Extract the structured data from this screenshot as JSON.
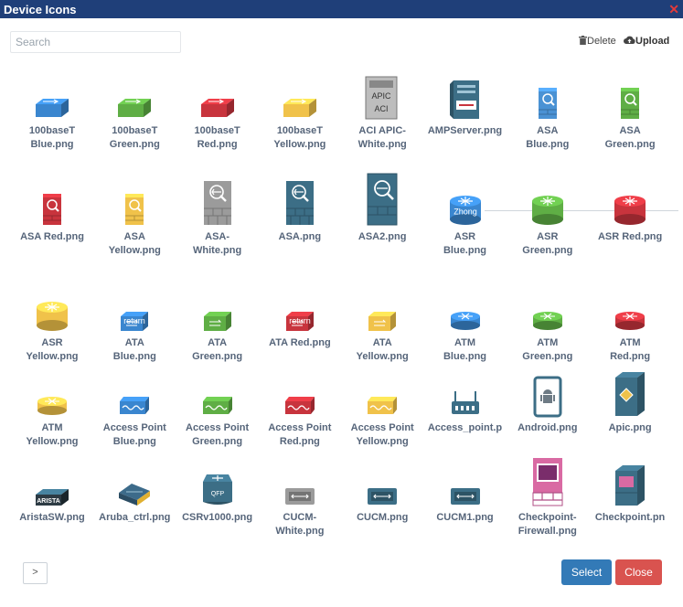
{
  "window": {
    "title": "Device Icons",
    "close_glyph": "✕"
  },
  "search": {
    "placeholder": "Search"
  },
  "toolbar": {
    "delete_label": "Delete",
    "upload_label": "Upload"
  },
  "footer": {
    "next_label": ">",
    "select_label": "Select",
    "close_label": "Close"
  },
  "icons": [
    {
      "label": "100baseT\nBlue.png",
      "type": "switch",
      "color": "#3a86cf"
    },
    {
      "label": "100baseT\nGreen.png",
      "type": "switch",
      "color": "#5fae45"
    },
    {
      "label": "100baseT\nRed.png",
      "type": "switch",
      "color": "#c8343d"
    },
    {
      "label": "100baseT\nYellow.png",
      "type": "switch",
      "color": "#f0c24a"
    },
    {
      "label": "ACI APIC-\nWhite.png",
      "type": "apic",
      "color": "#bdbdbd",
      "text1": "APIC",
      "text2": "ACI"
    },
    {
      "label": "AMPServer.png",
      "type": "server",
      "color": "#3c6e86"
    },
    {
      "label": "ASA\nBlue.png",
      "type": "asasmall",
      "color": "#4a92d4"
    },
    {
      "label": "ASA\nGreen.png",
      "type": "asasmall",
      "color": "#5fae45"
    },
    {
      "label": "ASA Red.png",
      "type": "asasmall",
      "color": "#c8343d"
    },
    {
      "label": "ASA\nYellow.png",
      "type": "asasmall",
      "color": "#f0c24a"
    },
    {
      "label": "ASA-\nWhite.png",
      "type": "asabig",
      "color": "#9b9b9b"
    },
    {
      "label": "ASA.png",
      "type": "asabig",
      "color": "#3c6e86"
    },
    {
      "label": "ASA2.png",
      "type": "asabig2",
      "color": "#3c6e86"
    },
    {
      "label": "ASR\nBlue.png",
      "type": "router",
      "color": "#3a86cf",
      "overlay": "Zhong"
    },
    {
      "label": "ASR\nGreen.png",
      "type": "router",
      "color": "#5fae45"
    },
    {
      "label": "ASR Red.png",
      "type": "router",
      "color": "#c8343d"
    },
    {
      "label": "ASR\nYellow.png",
      "type": "router",
      "color": "#f0c24a"
    },
    {
      "label": "ATA\nBlue.png",
      "type": "ata",
      "color": "#3a86cf",
      "overlay": "return"
    },
    {
      "label": "ATA\nGreen.png",
      "type": "ata",
      "color": "#5fae45"
    },
    {
      "label": "ATA Red.png",
      "type": "ata",
      "color": "#c8343d",
      "overlay": "return"
    },
    {
      "label": "ATA\nYellow.png",
      "type": "ata",
      "color": "#f0c24a"
    },
    {
      "label": "ATM\nBlue.png",
      "type": "atm",
      "color": "#3a86cf"
    },
    {
      "label": "ATM\nGreen.png",
      "type": "atm",
      "color": "#5fae45"
    },
    {
      "label": "ATM\nRed.png",
      "type": "atm",
      "color": "#c8343d"
    },
    {
      "label": "ATM\nYellow.png",
      "type": "atm",
      "color": "#f0c24a"
    },
    {
      "label": "Access Point\nBlue.png",
      "type": "ap",
      "color": "#3a86cf"
    },
    {
      "label": "Access Point\nGreen.png",
      "type": "ap",
      "color": "#5fae45"
    },
    {
      "label": "Access Point\nRed.png",
      "type": "ap",
      "color": "#c8343d"
    },
    {
      "label": "Access Point\nYellow.png",
      "type": "ap",
      "color": "#f0c24a"
    },
    {
      "label": "Access_point.p",
      "type": "wap",
      "color": "#3c6e86"
    },
    {
      "label": "Android.png",
      "type": "android",
      "color": "#3c6e86"
    },
    {
      "label": "Apic.png",
      "type": "apicbox",
      "color": "#3c6e86"
    },
    {
      "label": "AristaSW.png",
      "type": "arista",
      "color": "#3c6e86",
      "text1": "ARISTA"
    },
    {
      "label": "Aruba_ctrl.png",
      "type": "aruba",
      "color": "#3c6e86"
    },
    {
      "label": "CSRv1000.png",
      "type": "csr",
      "color": "#3c6e86",
      "text1": "QFP"
    },
    {
      "label": "CUCM-\nWhite.png",
      "type": "cucm",
      "color": "#9b9b9b"
    },
    {
      "label": "CUCM.png",
      "type": "cucm",
      "color": "#3c6e86"
    },
    {
      "label": "CUCM1.png",
      "type": "cucm",
      "color": "#3c6e86"
    },
    {
      "label": "Checkpoint-\nFirewall.png",
      "type": "checkpoint",
      "color": "#d96aa3"
    },
    {
      "label": "Checkpoint.pn",
      "type": "checkpoint2",
      "color": "#3c6e86"
    }
  ]
}
